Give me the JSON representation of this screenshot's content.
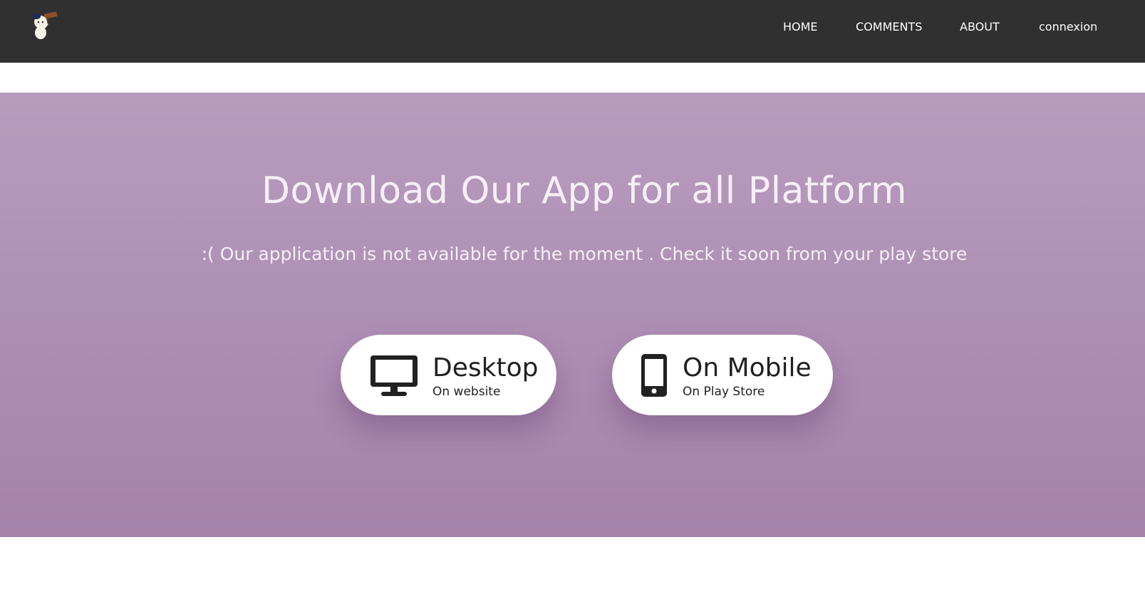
{
  "navbar": {
    "logo_icon": "mascot-logo-icon",
    "links": [
      {
        "label": "HOME"
      },
      {
        "label": "COMMENTS"
      },
      {
        "label": "ABOUT"
      },
      {
        "label": "connexion"
      }
    ]
  },
  "hero": {
    "title": "Download Our App for all Platform",
    "subtitle": ":( Our application is not available for the moment . Check it soon from your play store",
    "buttons": [
      {
        "title": "Desktop",
        "subtitle": "On website",
        "icon": "desktop-monitor-icon"
      },
      {
        "title": "On Mobile",
        "subtitle": "On Play Store",
        "icon": "mobile-phone-icon"
      }
    ]
  },
  "colors": {
    "navbar_bg": "#303030",
    "hero_gradient_top": "#b79cbe",
    "hero_gradient_bottom": "#a682ab",
    "text_light": "#f7eef8",
    "button_bg": "#ffffff",
    "button_text": "#212121"
  }
}
